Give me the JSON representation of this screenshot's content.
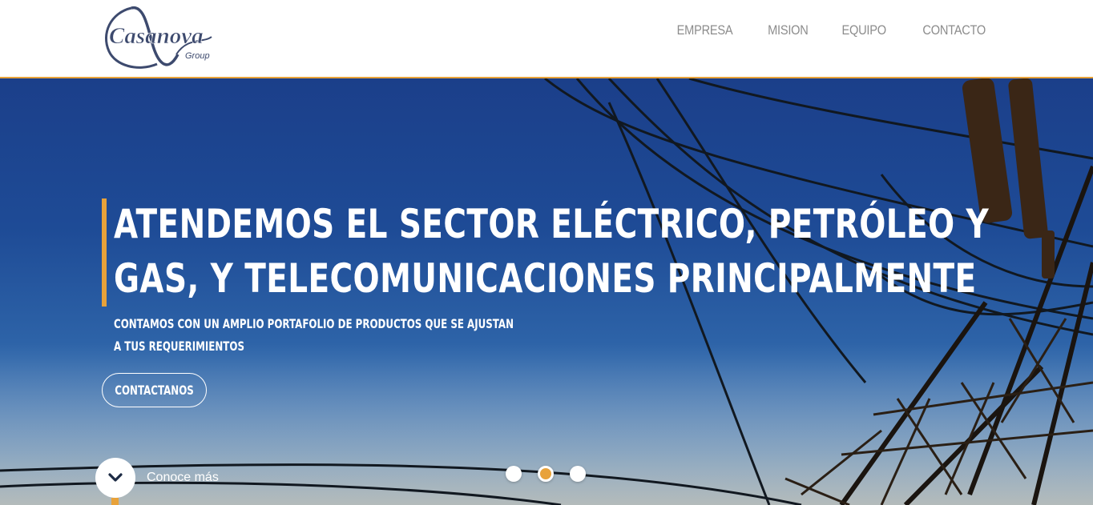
{
  "brand": {
    "name": "Casanova",
    "sub": "Group",
    "colors": {
      "accent": "#e8a23a",
      "logo": "#3d4a6e"
    }
  },
  "nav": [
    {
      "label": "EMPRESA"
    },
    {
      "label": "MISION"
    },
    {
      "label": "EQUIPO"
    },
    {
      "label": "CONTACTO"
    }
  ],
  "hero": {
    "headline_line1": "ATENDEMOS EL SECTOR ELÉCTRICO, PETRÓLEO Y",
    "headline_line2": "GAS, Y TELECOMUNICACIONES PRINCIPALMENTE",
    "subtitle_line1": "CONTAMOS CON UN AMPLIO PORTAFOLIO DE PRODUCTOS QUE SE AJUSTAN",
    "subtitle_line2": "A TUS REQUERIMIENTOS",
    "cta_label": "CONTACTANOS",
    "more_label": "Conoce más",
    "more_icon": "chevron-down-icon",
    "slides": {
      "count": 3,
      "active": 2
    }
  }
}
